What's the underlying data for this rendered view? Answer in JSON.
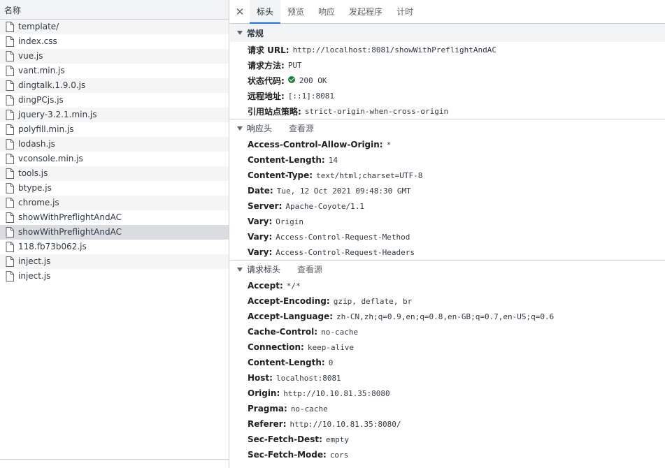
{
  "left": {
    "header": "名称",
    "files": [
      {
        "name": "template/"
      },
      {
        "name": "index.css"
      },
      {
        "name": "vue.js"
      },
      {
        "name": "vant.min.js"
      },
      {
        "name": "dingtalk.1.9.0.js"
      },
      {
        "name": "dingPCjs.js"
      },
      {
        "name": "jquery-3.2.1.min.js"
      },
      {
        "name": "polyfill.min.js"
      },
      {
        "name": "lodash.js"
      },
      {
        "name": "vconsole.min.js"
      },
      {
        "name": "tools.js"
      },
      {
        "name": "btype.js"
      },
      {
        "name": "chrome.js"
      },
      {
        "name": "showWithPreflightAndAC"
      },
      {
        "name": "showWithPreflightAndAC"
      },
      {
        "name": "118.fb73b062.js"
      },
      {
        "name": "inject.js"
      },
      {
        "name": "inject.js"
      }
    ],
    "selected_index": 14
  },
  "tabs": [
    "标头",
    "预览",
    "响应",
    "发起程序",
    "计时"
  ],
  "active_tab": 0,
  "general": {
    "title": "常规",
    "rows": [
      {
        "key": "请求 URL:",
        "value": "http://localhost:8081/showWithPreflightAndAC"
      },
      {
        "key": "请求方法:",
        "value": "PUT"
      },
      {
        "key": "状态代码:",
        "value": "200 OK"
      },
      {
        "key": "远程地址:",
        "value": "[::1]:8081"
      },
      {
        "key": "引用站点策略:",
        "value": "strict-origin-when-cross-origin"
      }
    ]
  },
  "response_headers": {
    "title": "响应头",
    "view_source": "查看源",
    "rows": [
      {
        "key": "Access-Control-Allow-Origin:",
        "value": "*"
      },
      {
        "key": "Content-Length:",
        "value": "14"
      },
      {
        "key": "Content-Type:",
        "value": "text/html;charset=UTF-8"
      },
      {
        "key": "Date:",
        "value": "Tue, 12 Oct 2021 09:48:30 GMT"
      },
      {
        "key": "Server:",
        "value": "Apache-Coyote/1.1"
      },
      {
        "key": "Vary:",
        "value": "Origin"
      },
      {
        "key": "Vary:",
        "value": "Access-Control-Request-Method"
      },
      {
        "key": "Vary:",
        "value": "Access-Control-Request-Headers"
      }
    ]
  },
  "request_headers": {
    "title": "请求标头",
    "view_source": "查看源",
    "rows": [
      {
        "key": "Accept:",
        "value": "*/*"
      },
      {
        "key": "Accept-Encoding:",
        "value": "gzip, deflate, br"
      },
      {
        "key": "Accept-Language:",
        "value": "zh-CN,zh;q=0.9,en;q=0.8,en-GB;q=0.7,en-US;q=0.6"
      },
      {
        "key": "Cache-Control:",
        "value": "no-cache"
      },
      {
        "key": "Connection:",
        "value": "keep-alive"
      },
      {
        "key": "Content-Length:",
        "value": "0"
      },
      {
        "key": "Host:",
        "value": "localhost:8081"
      },
      {
        "key": "Origin:",
        "value": "http://10.10.81.35:8080"
      },
      {
        "key": "Pragma:",
        "value": "no-cache"
      },
      {
        "key": "Referer:",
        "value": "http://10.10.81.35:8080/"
      },
      {
        "key": "Sec-Fetch-Dest:",
        "value": "empty"
      },
      {
        "key": "Sec-Fetch-Mode:",
        "value": "cors"
      }
    ]
  },
  "colors": {
    "accent": "#1a73e8",
    "status_ok": "#188038"
  },
  "icons": {
    "close": "close-icon",
    "file": "file-icon",
    "collapse": "triangle-down-icon",
    "status": "check-circle-icon"
  }
}
